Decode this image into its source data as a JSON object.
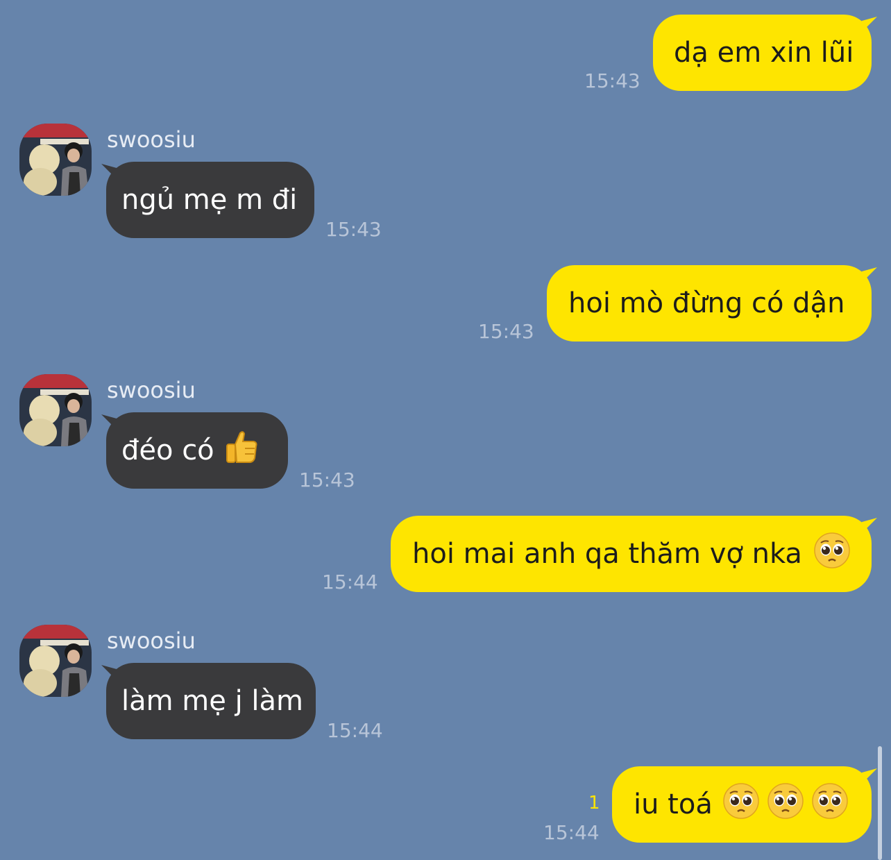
{
  "chat": {
    "messages": [
      {
        "side": "me",
        "text": "dạ em xin lũi",
        "time": "15:43"
      },
      {
        "side": "them",
        "sender": "swoosiu",
        "text": "ngủ mẹ m đi",
        "time": "15:43"
      },
      {
        "side": "me",
        "text": "hoi mò đừng có dận",
        "time": "15:43"
      },
      {
        "side": "them",
        "sender": "swoosiu",
        "text": "đéo có",
        "emoji": [
          "thumbs-up-icon"
        ],
        "time": "15:43"
      },
      {
        "side": "me",
        "text": "hoi mai anh qa thăm vợ nka",
        "emoji": [
          "pleading-face-icon"
        ],
        "time": "15:44"
      },
      {
        "side": "them",
        "sender": "swoosiu",
        "text": "làm mẹ j làm",
        "time": "15:44"
      },
      {
        "side": "me",
        "text": "iu toá",
        "emoji": [
          "pleading-face-icon",
          "pleading-face-icon",
          "pleading-face-icon"
        ],
        "time": "15:44",
        "unread": "1"
      }
    ]
  },
  "colors": {
    "background": "#6684ab",
    "my_bubble": "#fee500",
    "their_bubble": "#3a3a3c",
    "timestamp": "#b8c5d8",
    "unread": "#fee500"
  }
}
